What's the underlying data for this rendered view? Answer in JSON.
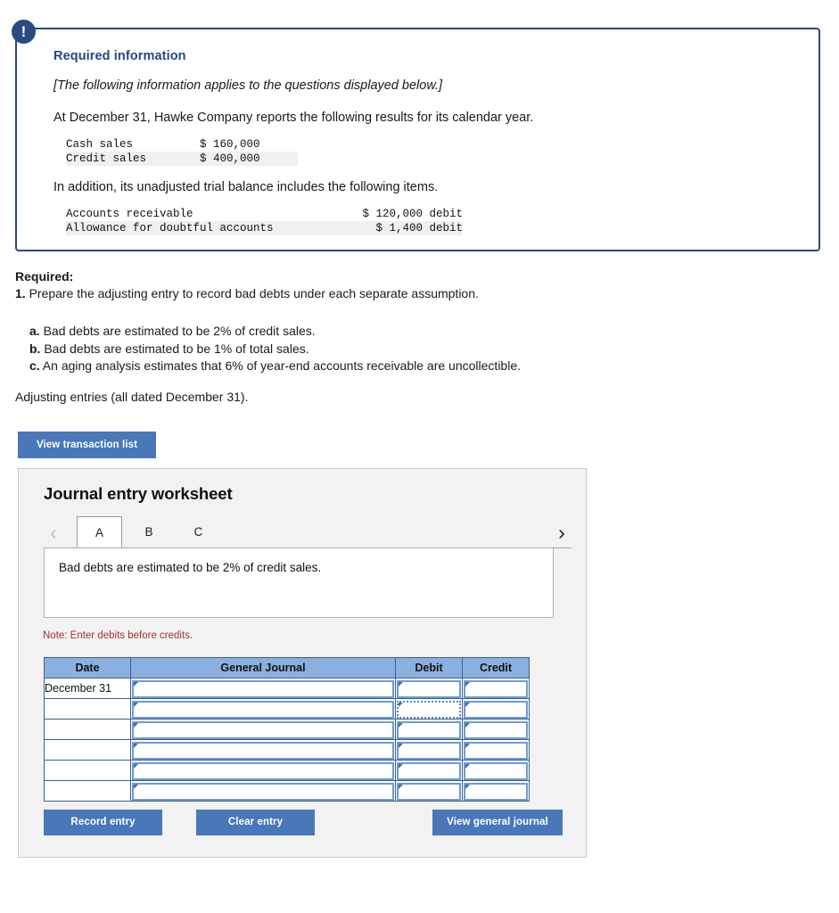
{
  "required_information": {
    "badge_icon": "exclamation-icon",
    "title": "Required information",
    "italic_note": "[The following information applies to the questions displayed below.]",
    "intro_line": "At December 31, Hawke Company reports the following results for its calendar year.",
    "sales_table": [
      {
        "label": "Cash sales",
        "value": "$ 160,000"
      },
      {
        "label": "Credit sales",
        "value": "$ 400,000"
      }
    ],
    "second_line": "In addition, its unadjusted trial balance includes the following items.",
    "balance_table": [
      {
        "label": "Accounts receivable",
        "value": "$ 120,000 debit"
      },
      {
        "label": "Allowance for doubtful accounts",
        "value": "$ 1,400 debit"
      }
    ]
  },
  "required_section": {
    "heading": "Required:",
    "item_number": "1.",
    "item_text": " Prepare the adjusting entry to record bad debts under each separate assumption.",
    "assumptions": [
      {
        "letter": "a.",
        "text": " Bad debts are estimated to be 2% of credit sales."
      },
      {
        "letter": "b.",
        "text": " Bad debts are estimated to be 1% of total sales."
      },
      {
        "letter": "c.",
        "text": " An aging analysis estimates that 6% of year-end accounts receivable are uncollectible."
      }
    ],
    "adjusting_note": "Adjusting entries (all dated December 31)."
  },
  "buttons": {
    "view_transaction_list": "View transaction list",
    "record_entry": "Record entry",
    "clear_entry": "Clear entry",
    "view_general_journal": "View general journal"
  },
  "worksheet": {
    "title": "Journal entry worksheet",
    "prev_icon": "chevron-left-icon",
    "next_icon": "chevron-right-icon",
    "tabs": [
      {
        "label": "A",
        "active": true
      },
      {
        "label": "B",
        "active": false
      },
      {
        "label": "C",
        "active": false
      }
    ],
    "description": "Bad debts are estimated to be 2% of credit sales.",
    "note": "Note: Enter debits before credits.",
    "table": {
      "headers": [
        "Date",
        "General Journal",
        "Debit",
        "Credit"
      ],
      "rows": [
        {
          "date": "December 31",
          "journal": "",
          "debit": "",
          "credit": "",
          "debit_focused": false
        },
        {
          "date": "",
          "journal": "",
          "debit": "",
          "credit": "",
          "debit_focused": true
        },
        {
          "date": "",
          "journal": "",
          "debit": "",
          "credit": "",
          "debit_focused": false
        },
        {
          "date": "",
          "journal": "",
          "debit": "",
          "credit": "",
          "debit_focused": false
        },
        {
          "date": "",
          "journal": "",
          "debit": "",
          "credit": "",
          "debit_focused": false
        },
        {
          "date": "",
          "journal": "",
          "debit": "",
          "credit": "",
          "debit_focused": false
        }
      ]
    }
  },
  "colors": {
    "callout_border": "#2b4a80",
    "heading_blue": "#26467f",
    "button_blue": "#4a77b8",
    "table_header_blue": "#8cb0de",
    "input_border_blue": "#6f9bd1",
    "note_red": "#a3332c",
    "panel_gray": "#f2f2f2"
  }
}
